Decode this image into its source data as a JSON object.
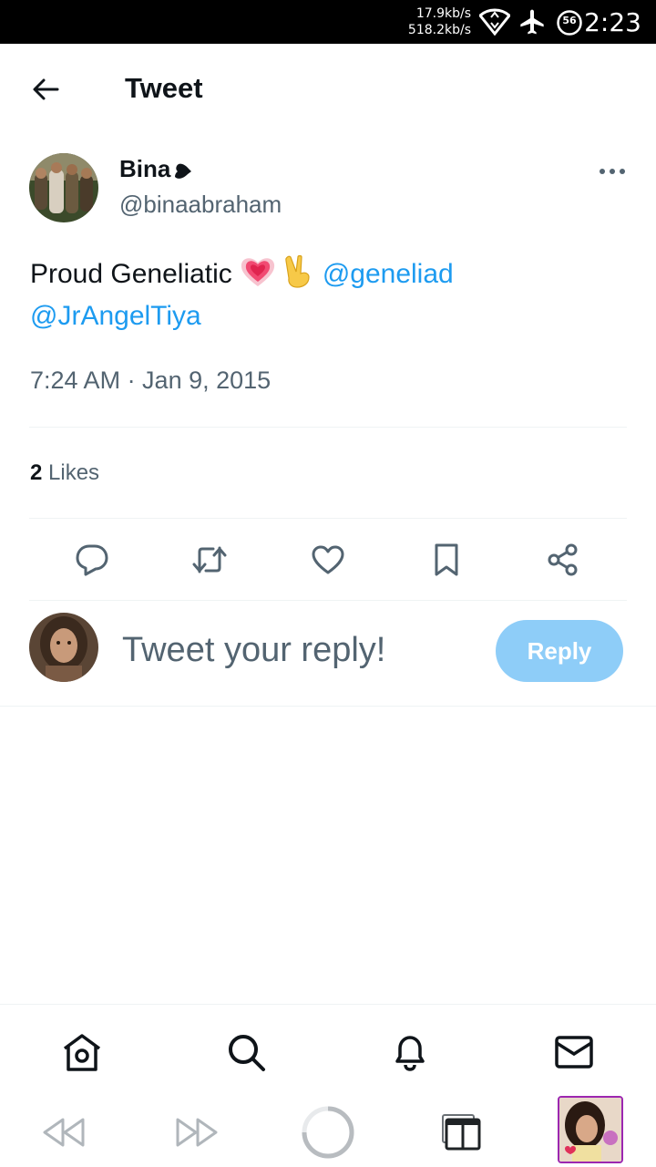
{
  "status_bar": {
    "upload_speed": "17.9kb/s",
    "download_speed": "518.2kb/s",
    "battery_level": "56",
    "time": "2:23",
    "icons": [
      "wifi-icon",
      "airplane-icon",
      "battery-icon"
    ]
  },
  "header": {
    "title": "Tweet",
    "back_icon": "back-arrow-icon"
  },
  "tweet": {
    "author_name": "Bina",
    "author_handle": "@binaabraham",
    "text_plain": "Proud Geneliatic",
    "mention_1": "@geneliad",
    "mention_2": "@JrAngelTiya",
    "emojis": [
      "growing-heart-emoji",
      "victory-hand-emoji"
    ],
    "timestamp": "7:24 AM · Jan 9, 2015",
    "likes_count": "2",
    "likes_label": "Likes"
  },
  "actions": [
    "reply-icon",
    "retweet-icon",
    "like-icon",
    "bookmark-icon",
    "share-icon"
  ],
  "reply_box": {
    "placeholder": "Tweet your reply!",
    "button_label": "Reply"
  },
  "bottom_nav": [
    "home-icon",
    "search-icon",
    "notifications-icon",
    "messages-icon"
  ],
  "browser_bar": [
    "back-rewind-icon",
    "forward-icon",
    "loading-icon",
    "tabs-icon",
    "tab-thumbnail"
  ],
  "colors": {
    "link": "#1d9bf0",
    "secondary_text": "#536471",
    "reply_button": "#8ecdf8",
    "divider": "#eff3f4"
  }
}
